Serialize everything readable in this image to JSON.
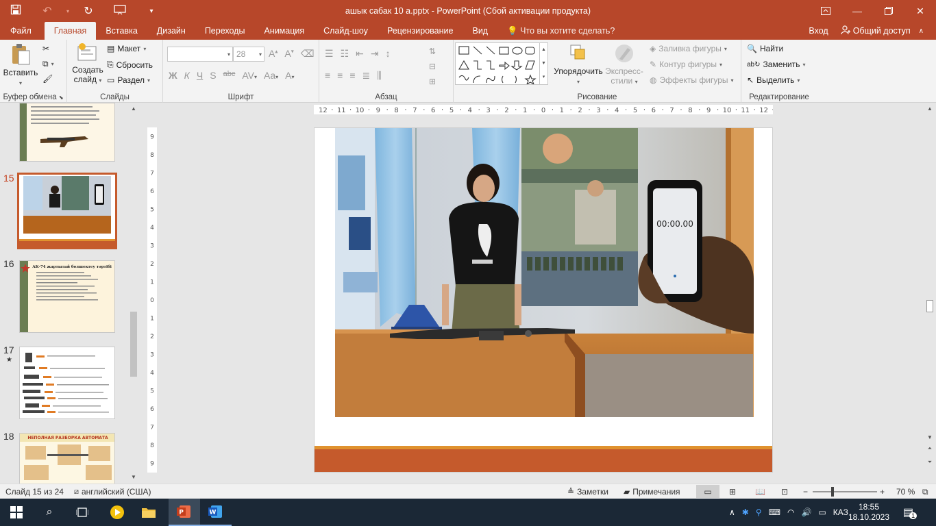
{
  "window": {
    "title": "ашык сабак 10 а.pptx  -  PowerPoint (Сбой активации продукта)"
  },
  "ribbon_tabs": [
    {
      "label": "Файл"
    },
    {
      "label": "Главная"
    },
    {
      "label": "Вставка"
    },
    {
      "label": "Дизайн"
    },
    {
      "label": "Переходы"
    },
    {
      "label": "Анимация"
    },
    {
      "label": "Слайд-шоу"
    },
    {
      "label": "Рецензирование"
    },
    {
      "label": "Вид"
    }
  ],
  "tell_me": "Что вы хотите сделать?",
  "signin": "Вход",
  "share": "Общий доступ",
  "clipboard": {
    "paste": "Вставить",
    "group": "Буфер обмена"
  },
  "slides_group": {
    "new_slide_line1": "Создать",
    "new_slide_line2": "слайд",
    "layout": "Макет",
    "reset": "Сбросить",
    "section": "Раздел",
    "group": "Слайды"
  },
  "font_group": {
    "size": "28",
    "bold": "Ж",
    "italic": "К",
    "underline": "Ч",
    "shadow": "S",
    "strike": "abc",
    "group": "Шрифт"
  },
  "paragraph_group": {
    "group": "Абзац"
  },
  "drawing_group": {
    "arrange": "Упорядочить",
    "quick_styles_line1": "Экспресс-",
    "quick_styles_line2": "стили",
    "fill": "Заливка фигуры",
    "outline": "Контур фигуры",
    "effects": "Эффекты фигуры",
    "group": "Рисование"
  },
  "editing_group": {
    "find": "Найти",
    "replace": "Заменить",
    "select": "Выделить",
    "group": "Редактирование"
  },
  "thumbnails": [
    {
      "num": "15",
      "active": true
    },
    {
      "num": "16"
    },
    {
      "num": "17"
    },
    {
      "num": "18"
    }
  ],
  "thumb16_title": "АК-74 жартылай бөлшектеу тәртібі",
  "thumb18_title": "НЕПОЛНАЯ РАЗБОРКА АВТОМАТА",
  "ruler": {
    "h_ticks": [
      "12",
      "11",
      "10",
      "9",
      "8",
      "7",
      "6",
      "5",
      "4",
      "3",
      "2",
      "1",
      "0",
      "1",
      "2",
      "3",
      "4",
      "5",
      "6",
      "7",
      "8",
      "9",
      "10",
      "11",
      "12"
    ],
    "v_ticks": [
      "9",
      "8",
      "7",
      "6",
      "5",
      "4",
      "3",
      "2",
      "1",
      "0",
      "1",
      "2",
      "3",
      "4",
      "5",
      "6",
      "7",
      "8",
      "9"
    ]
  },
  "slide": {
    "stopwatch": "00:00.00",
    "accent_color": "#c55a2c",
    "stripe_color": "#e0922f"
  },
  "status": {
    "slide_info": "Слайд 15 из 24",
    "language": "английский (США)",
    "notes": "Заметки",
    "comments": "Примечания",
    "zoom": "70 %"
  },
  "taskbar": {
    "lang": "КАЗ",
    "time": "18:55",
    "date": "18.10.2023",
    "notif_count": "1"
  }
}
